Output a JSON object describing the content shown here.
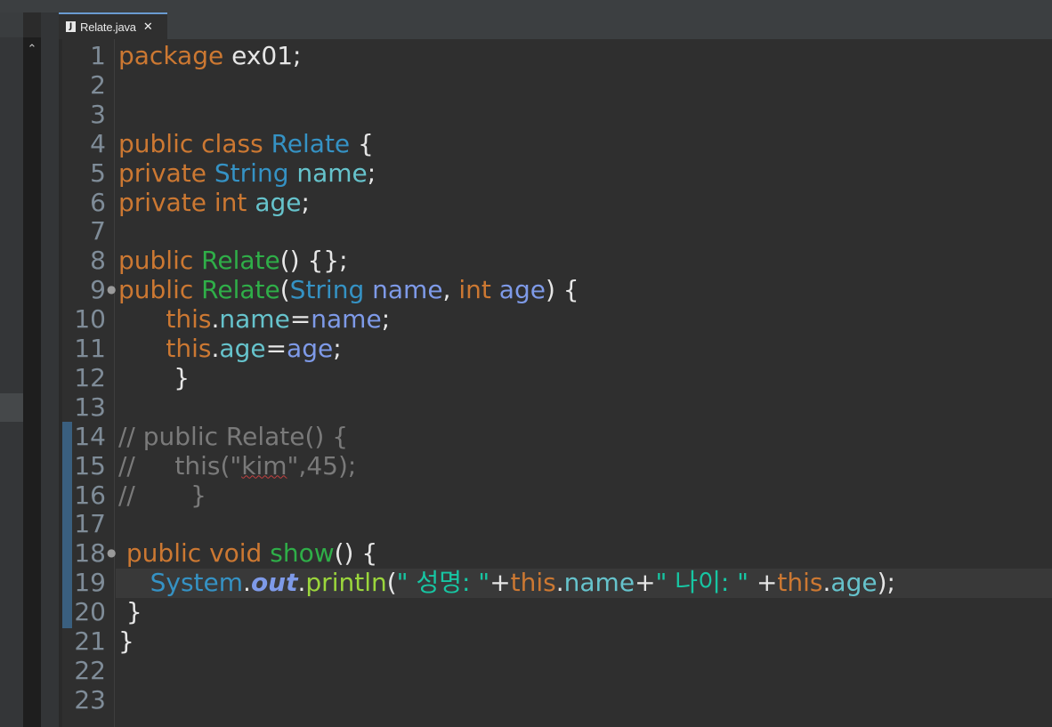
{
  "editor_tab": {
    "title": "Relate.java",
    "close_glyph": "✕",
    "file_icon": "java-file-icon"
  },
  "left_panel": {
    "scroll_up_glyph": "⌃"
  },
  "colors": {
    "keyword": "#cc7832",
    "type": "#3592c4",
    "field": "#66c3cc",
    "parameter": "#7e9ae8",
    "constructor": "#2fae48",
    "comment": "#7a7a7a",
    "string": "#17c6a3",
    "plain": "#e6e6e6",
    "line_number": "#7f8c98",
    "current_line": "#393939",
    "background": "#2f2f2f"
  },
  "lines": [
    {
      "num": "1",
      "fold": "",
      "tokens": [
        {
          "t": "package",
          "c": "kw"
        },
        {
          "t": " ex01;",
          "c": "pl"
        }
      ]
    },
    {
      "num": "2",
      "fold": "",
      "tokens": []
    },
    {
      "num": "3",
      "fold": "",
      "tokens": []
    },
    {
      "num": "4",
      "fold": "",
      "tokens": [
        {
          "t": "public",
          "c": "kw"
        },
        {
          "t": " ",
          "c": "pl"
        },
        {
          "t": "class",
          "c": "kw"
        },
        {
          "t": " ",
          "c": "pl"
        },
        {
          "t": "Relate",
          "c": "ty"
        },
        {
          "t": " {",
          "c": "pl"
        }
      ]
    },
    {
      "num": "5",
      "fold": "",
      "tokens": [
        {
          "t": "private",
          "c": "kw"
        },
        {
          "t": " ",
          "c": "pl"
        },
        {
          "t": "String",
          "c": "ty"
        },
        {
          "t": " ",
          "c": "pl"
        },
        {
          "t": "name",
          "c": "fld"
        },
        {
          "t": ";",
          "c": "pl"
        }
      ]
    },
    {
      "num": "6",
      "fold": "",
      "tokens": [
        {
          "t": "private",
          "c": "kw"
        },
        {
          "t": " ",
          "c": "pl"
        },
        {
          "t": "int",
          "c": "kw"
        },
        {
          "t": " ",
          "c": "pl"
        },
        {
          "t": "age",
          "c": "fld"
        },
        {
          "t": ";",
          "c": "pl"
        }
      ]
    },
    {
      "num": "7",
      "fold": "",
      "tokens": []
    },
    {
      "num": "8",
      "fold": "",
      "tokens": [
        {
          "t": "public",
          "c": "kw"
        },
        {
          "t": " ",
          "c": "pl"
        },
        {
          "t": "Relate",
          "c": "ctor"
        },
        {
          "t": "() {};",
          "c": "pl"
        }
      ]
    },
    {
      "num": "9",
      "fold": "●",
      "tokens": [
        {
          "t": "public",
          "c": "kw"
        },
        {
          "t": " ",
          "c": "pl"
        },
        {
          "t": "Relate",
          "c": "ctor"
        },
        {
          "t": "(",
          "c": "pl"
        },
        {
          "t": "String",
          "c": "ty"
        },
        {
          "t": " ",
          "c": "pl"
        },
        {
          "t": "name",
          "c": "prm"
        },
        {
          "t": ", ",
          "c": "pl"
        },
        {
          "t": "int",
          "c": "kw"
        },
        {
          "t": " ",
          "c": "pl"
        },
        {
          "t": "age",
          "c": "prm"
        },
        {
          "t": ") {",
          "c": "pl"
        }
      ]
    },
    {
      "num": "10",
      "fold": "",
      "tokens": [
        {
          "t": "      ",
          "c": "pl"
        },
        {
          "t": "this",
          "c": "kw"
        },
        {
          "t": ".",
          "c": "pl"
        },
        {
          "t": "name",
          "c": "fld"
        },
        {
          "t": "=",
          "c": "pl"
        },
        {
          "t": "name",
          "c": "prm"
        },
        {
          "t": ";",
          "c": "pl"
        }
      ]
    },
    {
      "num": "11",
      "fold": "",
      "tokens": [
        {
          "t": "      ",
          "c": "pl"
        },
        {
          "t": "this",
          "c": "kw"
        },
        {
          "t": ".",
          "c": "pl"
        },
        {
          "t": "age",
          "c": "fld"
        },
        {
          "t": "=",
          "c": "pl"
        },
        {
          "t": "age",
          "c": "prm"
        },
        {
          "t": ";",
          "c": "pl"
        }
      ]
    },
    {
      "num": "12",
      "fold": "",
      "tokens": [
        {
          "t": "       }",
          "c": "pl"
        }
      ]
    },
    {
      "num": "13",
      "fold": "",
      "tokens": []
    },
    {
      "num": "14",
      "fold": "",
      "tokens": [
        {
          "t": "// public Relate() {",
          "c": "cm"
        }
      ]
    },
    {
      "num": "15",
      "fold": "",
      "tokens": [
        {
          "t": "//     this(\"",
          "c": "cm"
        },
        {
          "t": "kim",
          "c": "cm sq"
        },
        {
          "t": "\",45);",
          "c": "cm"
        }
      ]
    },
    {
      "num": "16",
      "fold": "",
      "tokens": [
        {
          "t": "//       }",
          "c": "cm"
        }
      ]
    },
    {
      "num": "17",
      "fold": "",
      "tokens": []
    },
    {
      "num": "18",
      "fold": "●",
      "tokens": [
        {
          "t": " public",
          "c": "kw"
        },
        {
          "t": " ",
          "c": "pl"
        },
        {
          "t": "void",
          "c": "kw"
        },
        {
          "t": " ",
          "c": "pl"
        },
        {
          "t": "show",
          "c": "ctor"
        },
        {
          "t": "() {",
          "c": "pl"
        }
      ]
    },
    {
      "num": "19",
      "fold": "",
      "tokens": [
        {
          "t": "    ",
          "c": "pl"
        },
        {
          "t": "System",
          "c": "sys"
        },
        {
          "t": ".",
          "c": "pl"
        },
        {
          "t": "out",
          "c": "out"
        },
        {
          "t": ".",
          "c": "pl"
        },
        {
          "t": "println",
          "c": "mth"
        },
        {
          "t": "(",
          "c": "pl"
        },
        {
          "t": "\" 성명: \"",
          "c": "str"
        },
        {
          "t": "+",
          "c": "pl"
        },
        {
          "t": "this",
          "c": "kw"
        },
        {
          "t": ".",
          "c": "pl"
        },
        {
          "t": "name",
          "c": "fld"
        },
        {
          "t": "+",
          "c": "pl"
        },
        {
          "t": "\" 나이: \"",
          "c": "str"
        },
        {
          "t": " +",
          "c": "pl"
        },
        {
          "t": "this",
          "c": "kw"
        },
        {
          "t": ".",
          "c": "pl"
        },
        {
          "t": "age",
          "c": "fld"
        },
        {
          "t": ");",
          "c": "pl"
        }
      ]
    },
    {
      "num": "20",
      "fold": "",
      "tokens": [
        {
          "t": " }",
          "c": "pl"
        }
      ]
    },
    {
      "num": "21",
      "fold": "",
      "tokens": [
        {
          "t": "}",
          "c": "pl"
        }
      ]
    },
    {
      "num": "22",
      "fold": "",
      "tokens": []
    },
    {
      "num": "23",
      "fold": "",
      "tokens": []
    }
  ]
}
